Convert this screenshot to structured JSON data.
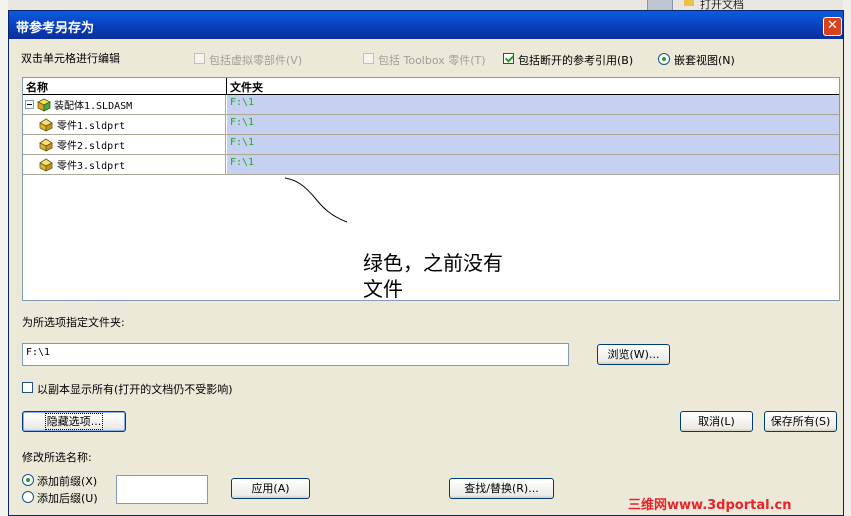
{
  "background": {
    "right_text": "打开文档"
  },
  "dialog": {
    "title": "带参考另存为",
    "close": "✕",
    "hint": "双击单元格进行编辑",
    "options": {
      "virtual": "包括虚拟零部件(V)",
      "toolbox": "包括 Toolbox 零件(T)",
      "broken_refs": "包括断开的参考引用(B)",
      "nested_view": "嵌套视图(N)"
    },
    "grid": {
      "columns": [
        "名称",
        "文件夹"
      ],
      "rows": [
        {
          "name": "装配体1.SLDASM",
          "folder": "F:\\1",
          "type": "assembly"
        },
        {
          "name": "零件1.sldprt",
          "folder": "F:\\1",
          "type": "part"
        },
        {
          "name": "零件2.sldprt",
          "folder": "F:\\1",
          "type": "part"
        },
        {
          "name": "零件3.sldprt",
          "folder": "F:\\1",
          "type": "part"
        }
      ]
    },
    "annotation": [
      "绿色，之前没有",
      "文件"
    ],
    "folder_label": "为所选项指定文件夹:",
    "folder_value": "F:\\1",
    "browse": "浏览(W)...",
    "show_all": "以副本显示所有(打开的文档仍不受影响)",
    "hide_options": "隐藏选项...",
    "cancel": "取消(L)",
    "save_all": "保存所有(S)",
    "rename_label": "修改所选名称:",
    "add_prefix": "添加前缀(X)",
    "add_suffix": "添加后缀(U)",
    "apply": "应用(A)",
    "find_replace": "查找/替换(R)...",
    "affix_value": ""
  },
  "watermark": "三维网www.3dportal.cn",
  "colors": {
    "titlebar": "#0a3db8",
    "folder_cell_bg": "#c6d0f0",
    "folder_text": "#1fa81f",
    "watermark": "#e8232a"
  }
}
